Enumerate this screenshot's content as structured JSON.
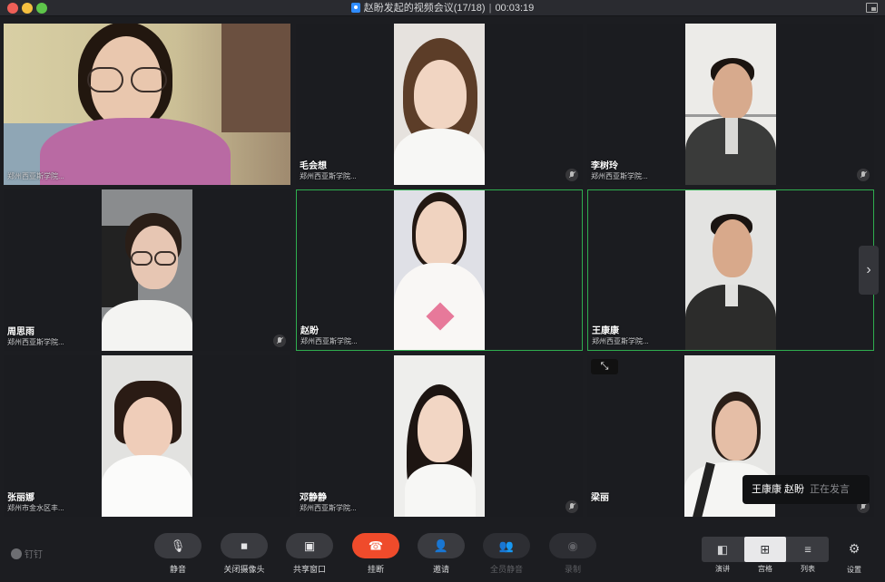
{
  "window": {
    "title": "赵盼发起的视频会议(17/18)",
    "timer": "00:03:19"
  },
  "participants": [
    {
      "name": "",
      "org": "郑州西亚斯学院..."
    },
    {
      "name": "毛会想",
      "org": "郑州西亚斯学院..."
    },
    {
      "name": "李树玲",
      "org": "郑州西亚斯学院..."
    },
    {
      "name": "周思雨",
      "org": "郑州西亚斯学院..."
    },
    {
      "name": "赵盼",
      "org": "郑州西亚斯学院..."
    },
    {
      "name": "王康康",
      "org": "郑州西亚斯学院..."
    },
    {
      "name": "张丽娜",
      "org": "郑州市金水区丰..."
    },
    {
      "name": "邓静静",
      "org": "郑州西亚斯学院..."
    },
    {
      "name": "梁丽",
      "org": ""
    }
  ],
  "speaking": {
    "speakers": "王康康  赵盼",
    "status": "正在发言"
  },
  "brand": "钉钉",
  "toolbar": {
    "mute": "静音",
    "camera_off": "关闭摄像头",
    "share": "共享窗口",
    "hangup": "挂断",
    "invite": "邀请",
    "mute_all": "全员静音",
    "record": "录制"
  },
  "layout": {
    "speaker": "演讲",
    "grid": "宫格",
    "list": "列表",
    "settings": "设置"
  },
  "colors": {
    "active_border": "#2fae4f",
    "hangup": "#ef4b2b"
  }
}
